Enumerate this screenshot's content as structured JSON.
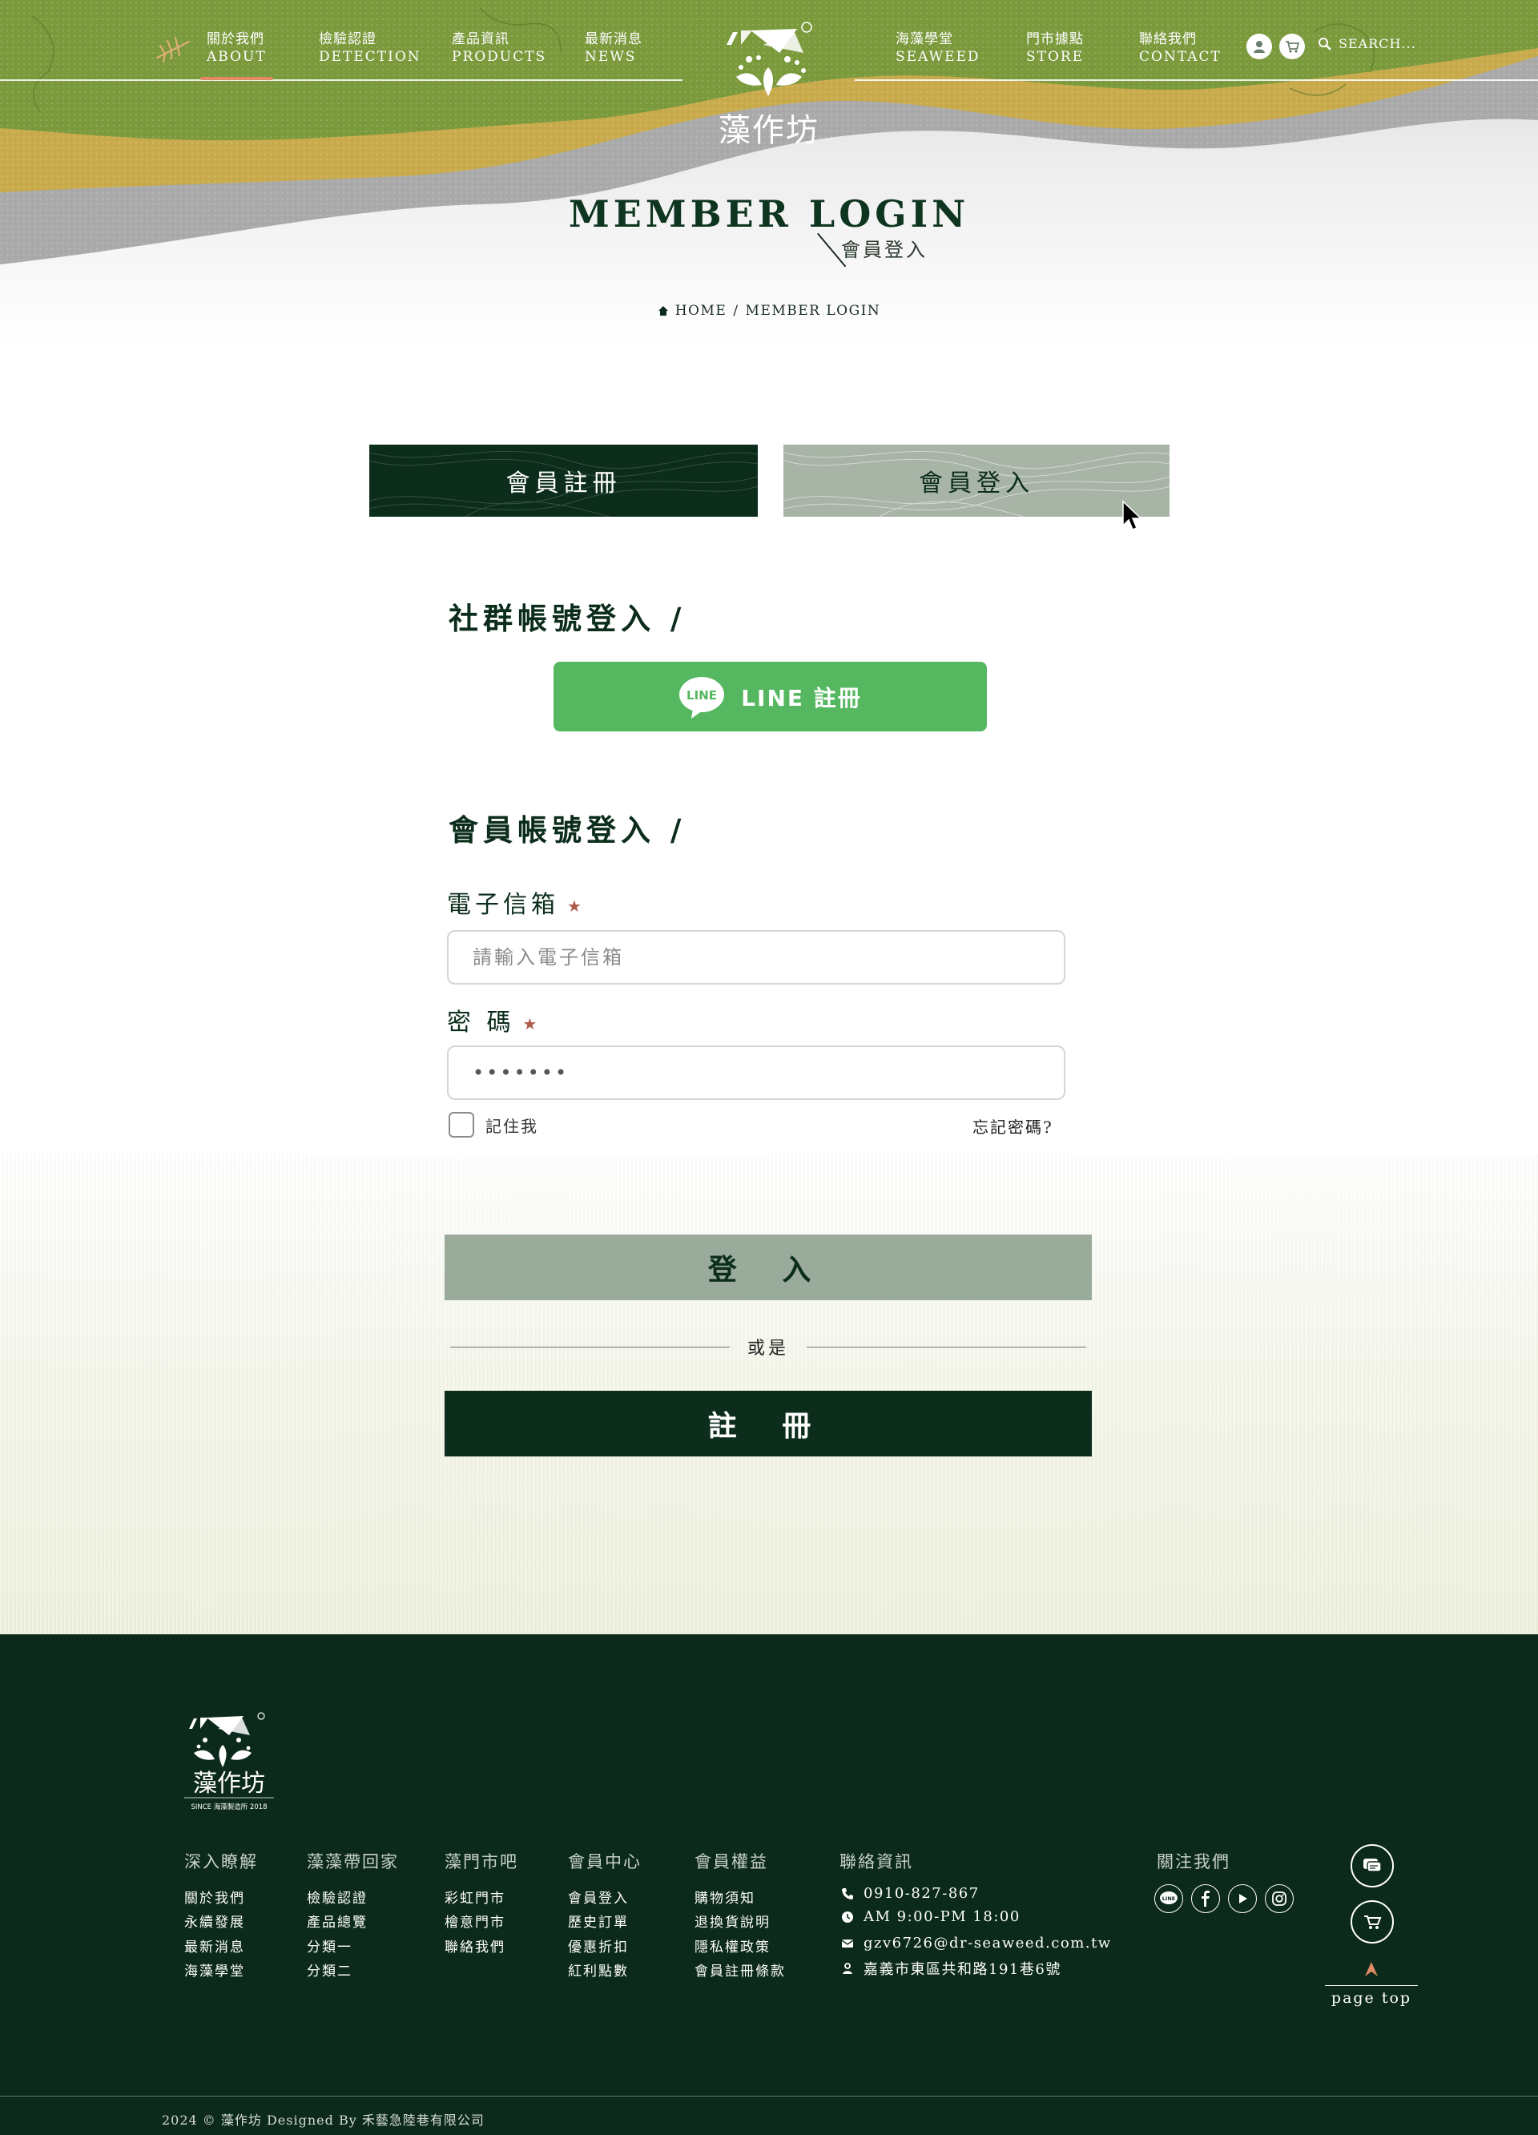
{
  "colors": {
    "brand_dark": "#0c2d1c",
    "accent": "#e08b63",
    "line_green": "#56b761",
    "olive": "#7b9a3c",
    "mustard": "#c9ab4c"
  },
  "nav": {
    "left": [
      {
        "zh": "關於我們",
        "en": "ABOUT",
        "active": true
      },
      {
        "zh": "檢驗認證",
        "en": "DETECTION"
      },
      {
        "zh": "產品資訊",
        "en": "PRODUCTS"
      },
      {
        "zh": "最新消息",
        "en": "NEWS"
      }
    ],
    "right": [
      {
        "zh": "海藻學堂",
        "en": "SEAWEED"
      },
      {
        "zh": "門市據點",
        "en": "STORE"
      },
      {
        "zh": "聯絡我們",
        "en": "CONTACT"
      }
    ],
    "brand_name": "藻作坊",
    "search_placeholder": "SEARCH...",
    "icons": [
      "member-icon",
      "cart-icon",
      "search-icon"
    ]
  },
  "hero": {
    "title": "MEMBER LOGIN",
    "subtitle": "會員登入",
    "breadcrumb": {
      "home": "HOME",
      "sep": "/",
      "current": "MEMBER LOGIN"
    }
  },
  "tabs": {
    "register": "會員註冊",
    "login": "會員登入"
  },
  "social_login": {
    "title": "社群帳號登入 /",
    "line_label": "LINE 註冊",
    "line_logo_text": "LINE"
  },
  "account_login": {
    "title": "會員帳號登入 /",
    "email_label": "電子信箱",
    "email_placeholder": "請輸入電子信箱",
    "password_label": "密 碼",
    "password_value": "•••••••",
    "required_mark": "★",
    "remember_label": "記住我",
    "forgot_label": "忘記密碼?"
  },
  "actions": {
    "login": "登 入",
    "or": "或是",
    "signup": "註 冊"
  },
  "footer": {
    "logo_name": "藻作坊",
    "logo_tagline": "SINCE 海藻製造所 2018",
    "columns": [
      {
        "title": "深入瞭解",
        "links": [
          "關於我們",
          "永續發展",
          "最新消息",
          "海藻學堂"
        ]
      },
      {
        "title": "藻藻帶回家",
        "links": [
          "檢驗認證",
          "產品總覽",
          "分類一",
          "分類二"
        ]
      },
      {
        "title": "藻門市吧",
        "links": [
          "彩虹門市",
          "檜意門市",
          "聯絡我們"
        ]
      },
      {
        "title": "會員中心",
        "links": [
          "會員登入",
          "歷史訂單",
          "優惠折扣",
          "紅利點數"
        ]
      },
      {
        "title": "會員權益",
        "links": [
          "購物須知",
          "退換貨說明",
          "隱私權政策",
          "會員註冊條款"
        ]
      }
    ],
    "contact": {
      "title": "聯絡資訊",
      "phone": "0910-827-867",
      "hours": "AM 9:00-PM 18:00",
      "email": "gzv6726@dr-seaweed.com.tw",
      "address": "嘉義市東區共和路191巷6號"
    },
    "follow": {
      "title": "關注我們",
      "icons": [
        "line-icon",
        "facebook-icon",
        "youtube-icon",
        "instagram-icon"
      ]
    },
    "page_top": "page top",
    "copyright": "2024 © 藻作坊 Designed By 禾藝急陸巷有限公司"
  }
}
